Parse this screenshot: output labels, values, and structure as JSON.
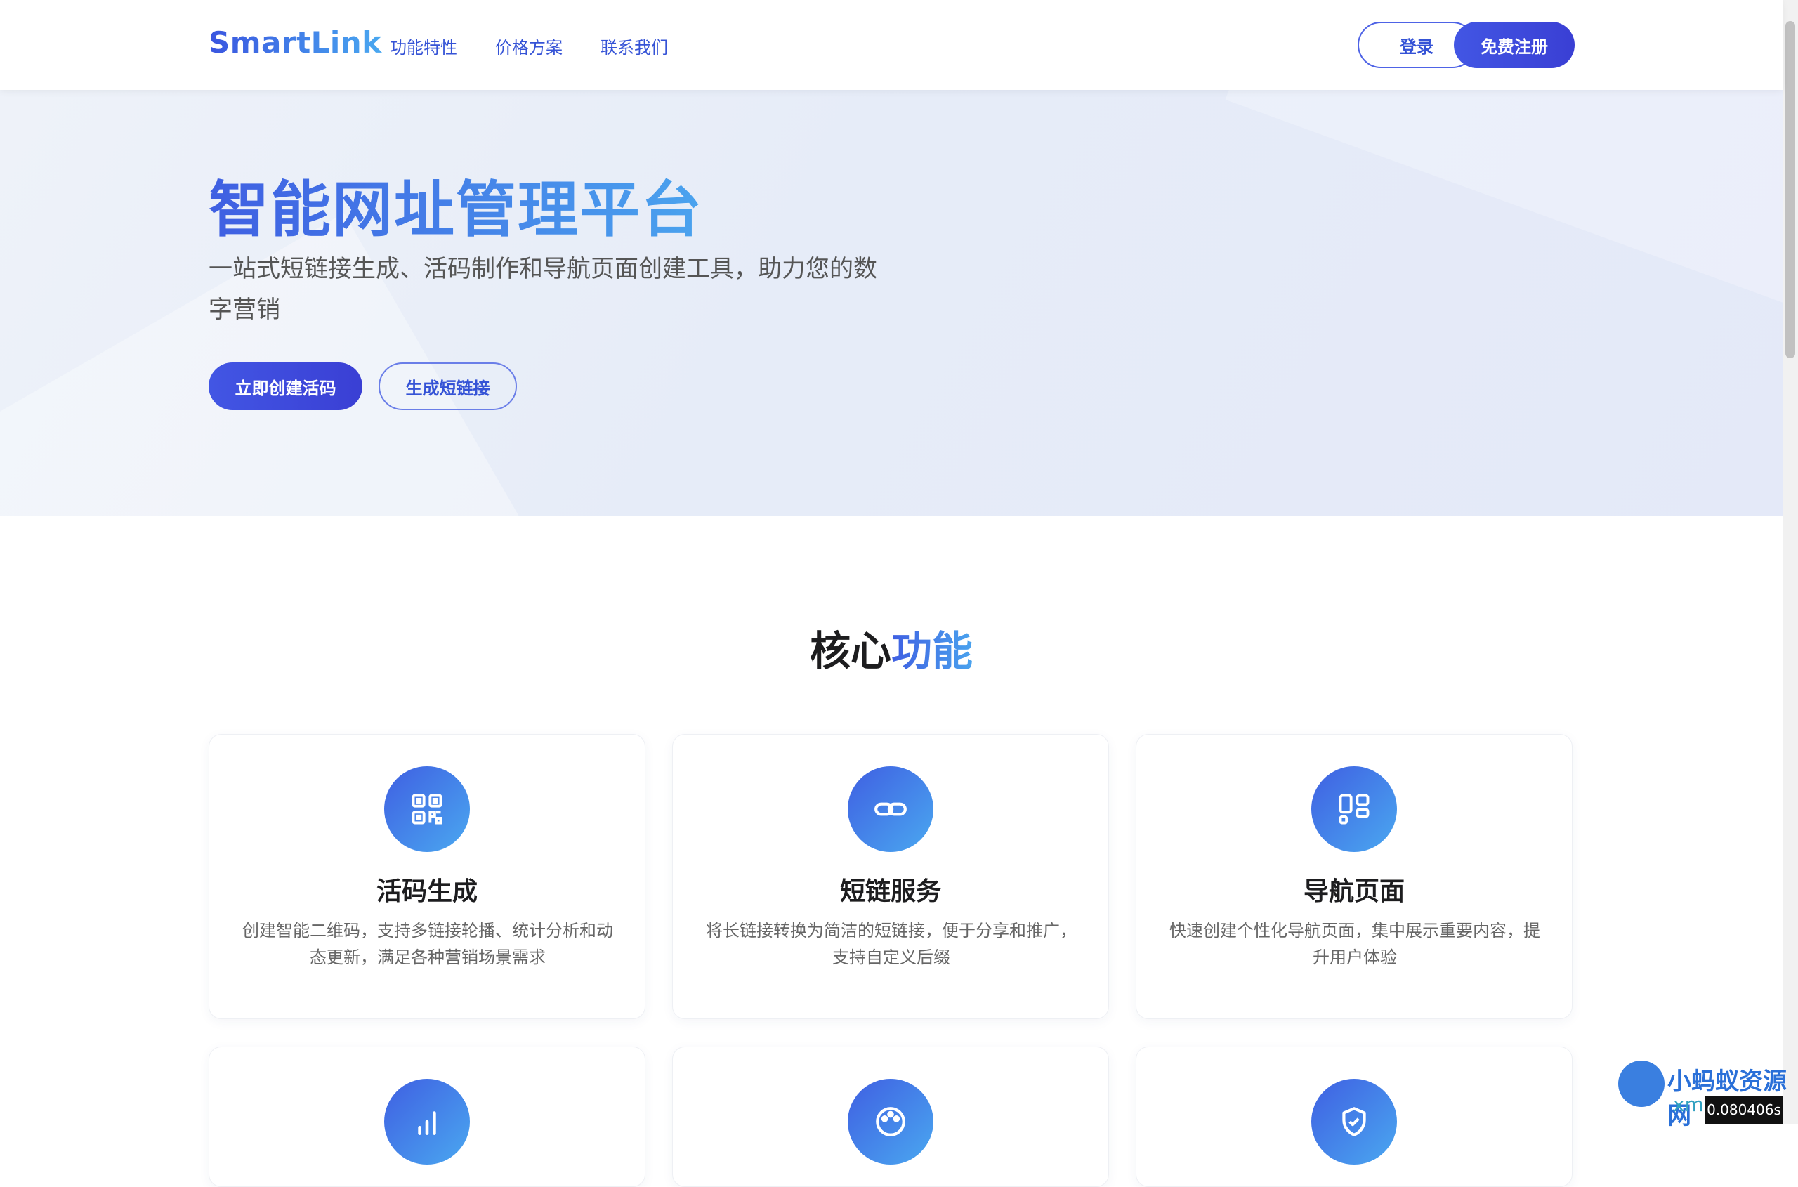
{
  "header": {
    "logo": "SmartLink",
    "nav": [
      "功能特性",
      "价格方案",
      "联系我们"
    ],
    "login": "登录",
    "register": "免费注册"
  },
  "hero": {
    "title": "智能网址管理平台",
    "subtitle": "一站式短链接生成、活码制作和导航页面创建工具，助力您的数字营销",
    "primary_button": "立即创建活码",
    "secondary_button": "生成短链接"
  },
  "features": {
    "title_prefix": "核心",
    "title_highlight": "功能",
    "cards": [
      {
        "icon": "qr-code-icon",
        "title": "活码生成",
        "desc": "创建智能二维码，支持多链接轮播、统计分析和动态更新，满足各种营销场景需求"
      },
      {
        "icon": "link-icon",
        "title": "短链服务",
        "desc": "将长链接转换为简洁的短链接，便于分享和推广，支持自定义后缀"
      },
      {
        "icon": "layout-icon",
        "title": "导航页面",
        "desc": "快速创建个性化导航页面，集中展示重要内容，提升用户体验"
      }
    ],
    "more_cards": [
      {
        "icon": "bar-chart-icon"
      },
      {
        "icon": "palette-icon"
      },
      {
        "icon": "shield-check-icon"
      }
    ]
  },
  "watermark": {
    "name": "小蚂蚁资源网",
    "url": "xmy7.com"
  },
  "timer": "0.080406s",
  "colors": {
    "primary": "#3f5fe2",
    "accent": "#4aa3ee"
  }
}
